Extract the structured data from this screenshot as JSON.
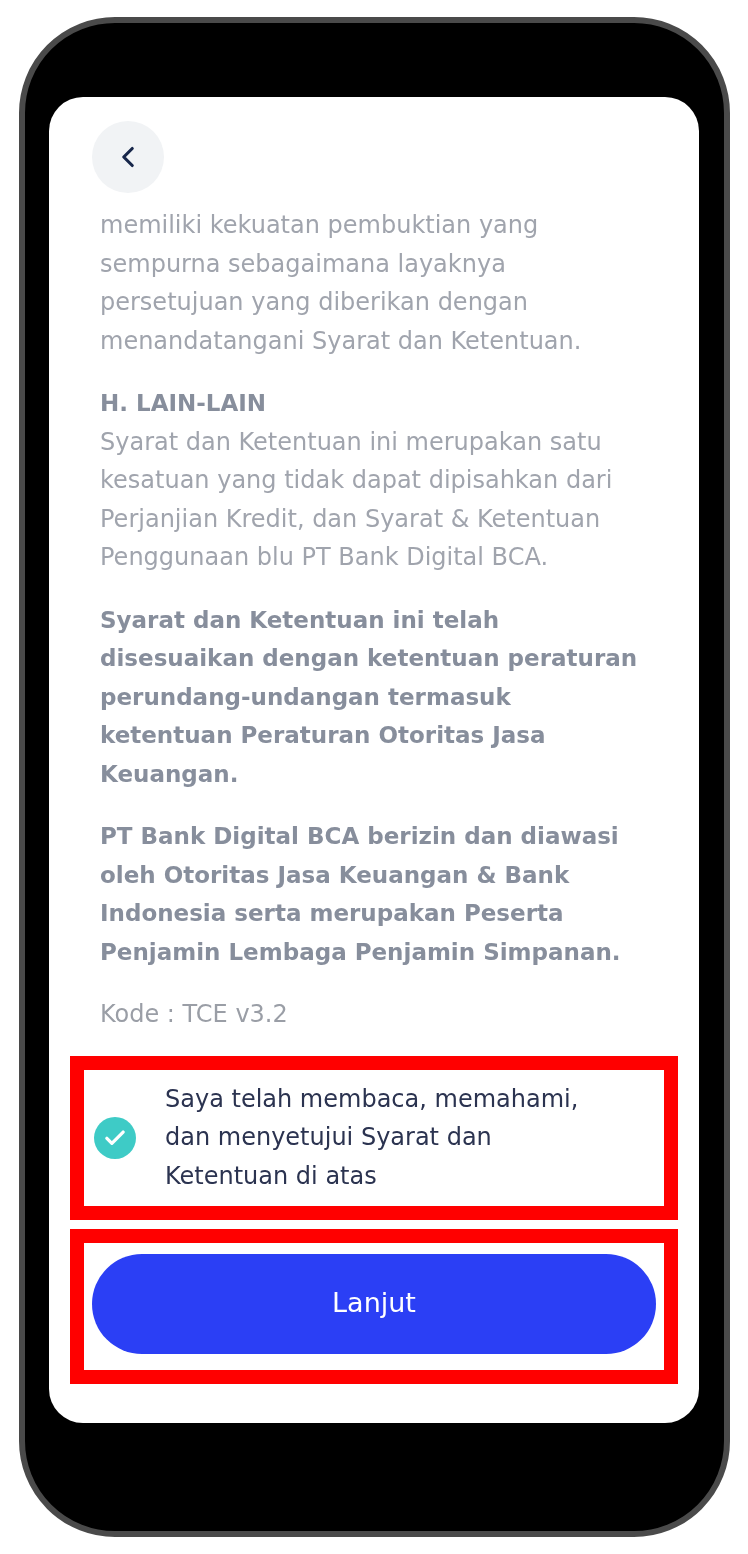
{
  "content": [
    {
      "kind": "paragraph",
      "text": "memiliki kekuatan pembuktian yang sempurna sebagaimana layaknya persetujuan yang diberikan dengan menandatangani Syarat dan Ketentuan."
    },
    {
      "kind": "section",
      "heading": "H. LAIN-LAIN",
      "text": "Syarat dan Ketentuan ini merupakan satu kesatuan yang tidak dapat dipisahkan dari Perjanjian Kredit, dan Syarat & Ketentuan Penggunaan blu PT Bank Digital BCA."
    },
    {
      "kind": "notice",
      "text": "Syarat dan Ketentuan ini telah disesuaikan dengan ketentuan peraturan perundang-undangan termasuk ketentuan Peraturan Otoritas Jasa Keuangan."
    },
    {
      "kind": "notice",
      "text": "PT Bank Digital BCA berizin dan diawasi oleh Otoritas Jasa Keuangan & Bank Indonesia serta merupakan Peserta Penjamin Lembaga Penjamin Simpanan."
    },
    {
      "kind": "code",
      "text": "Kode : TCE v3.2"
    }
  ],
  "agreement": {
    "text": "Saya telah membaca, memahami, dan menyetujui Syarat dan Ketentuan di atas",
    "checked": true,
    "highlighted": true
  },
  "continue_button": {
    "label": "Lanjut",
    "highlighted": true
  }
}
